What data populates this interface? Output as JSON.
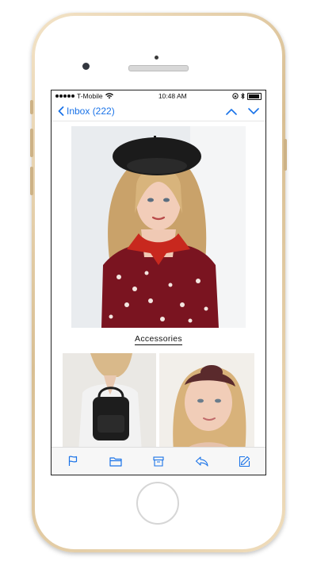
{
  "status": {
    "carrier": "T-Mobile",
    "time": "10:48 AM"
  },
  "nav": {
    "back_label": "Inbox (222)"
  },
  "email": {
    "section_heading": "Accessories"
  },
  "toolbar": {
    "icons": [
      "flag-icon",
      "folder-icon",
      "archive-icon",
      "reply-icon",
      "compose-icon"
    ]
  },
  "colors": {
    "accent": "#1a73e8",
    "phone_gold": "#e8d3ad",
    "dress_red": "#7a1420"
  }
}
